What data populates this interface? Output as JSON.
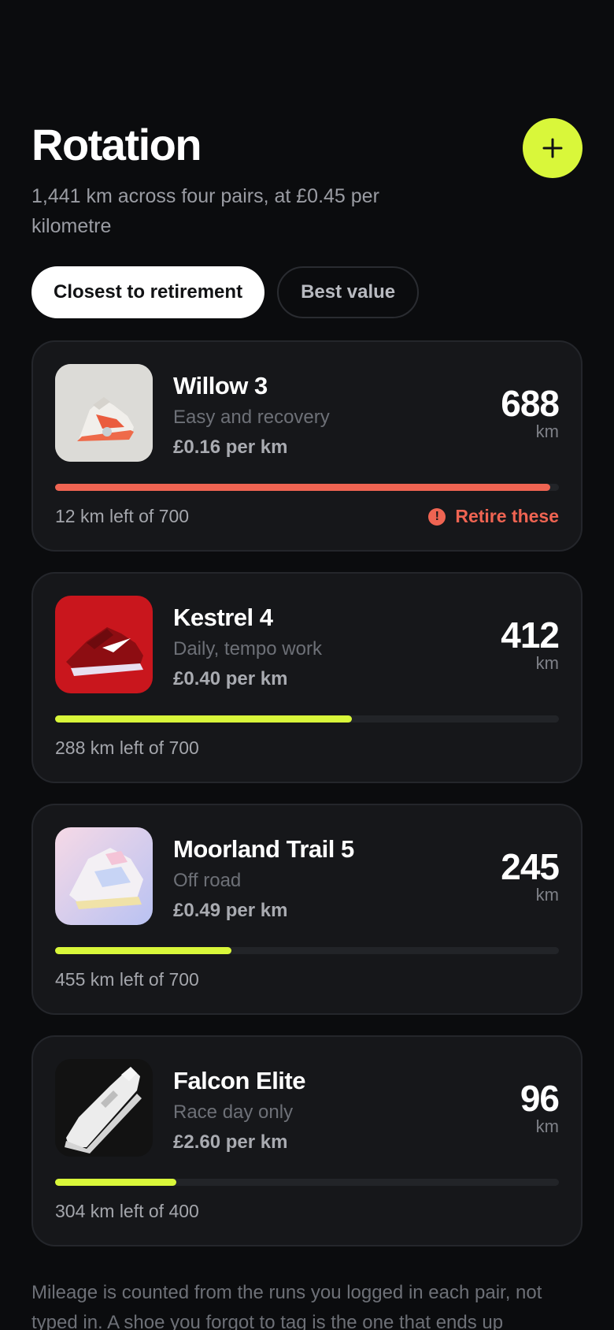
{
  "header": {
    "title": "Rotation",
    "subtitle": "1,441 km across four pairs, at £0.45 per kilometre",
    "add_icon": "plus-icon"
  },
  "filters": [
    {
      "label": "Closest to retirement",
      "active": true
    },
    {
      "label": "Best value",
      "active": false
    }
  ],
  "colors": {
    "accent": "#d9f73a",
    "warning": "#ef6452",
    "card": "#16171a",
    "background": "#0b0c0e"
  },
  "shoes": [
    {
      "name": "Willow 3",
      "usage": "Easy and recovery",
      "cost": "£0.16 per km",
      "km": "688",
      "unit": "km",
      "left_text": "12 km left of 700",
      "progress": 0.983,
      "status": "warning",
      "warning": "Retire these",
      "image": "white-orange-sneaker"
    },
    {
      "name": "Kestrel 4",
      "usage": "Daily, tempo work",
      "cost": "£0.40 per km",
      "km": "412",
      "unit": "km",
      "left_text": "288 km left of 700",
      "progress": 0.589,
      "status": "ok",
      "warning": "",
      "image": "red-running-shoe"
    },
    {
      "name": "Moorland Trail 5",
      "usage": "Off road",
      "cost": "£0.49 per km",
      "km": "245",
      "unit": "km",
      "left_text": "455 km left of 700",
      "progress": 0.35,
      "status": "ok",
      "warning": "",
      "image": "pastel-sneaker"
    },
    {
      "name": "Falcon Elite",
      "usage": "Race day only",
      "cost": "£2.60 per km",
      "km": "96",
      "unit": "km",
      "left_text": "304 km left of 400",
      "progress": 0.24,
      "status": "ok",
      "warning": "",
      "image": "white-low-sneaker"
    }
  ],
  "footnote": "Mileage is counted from the runs you logged in each pair, not typed in. A shoe you forgot to tag is the one that ends up"
}
